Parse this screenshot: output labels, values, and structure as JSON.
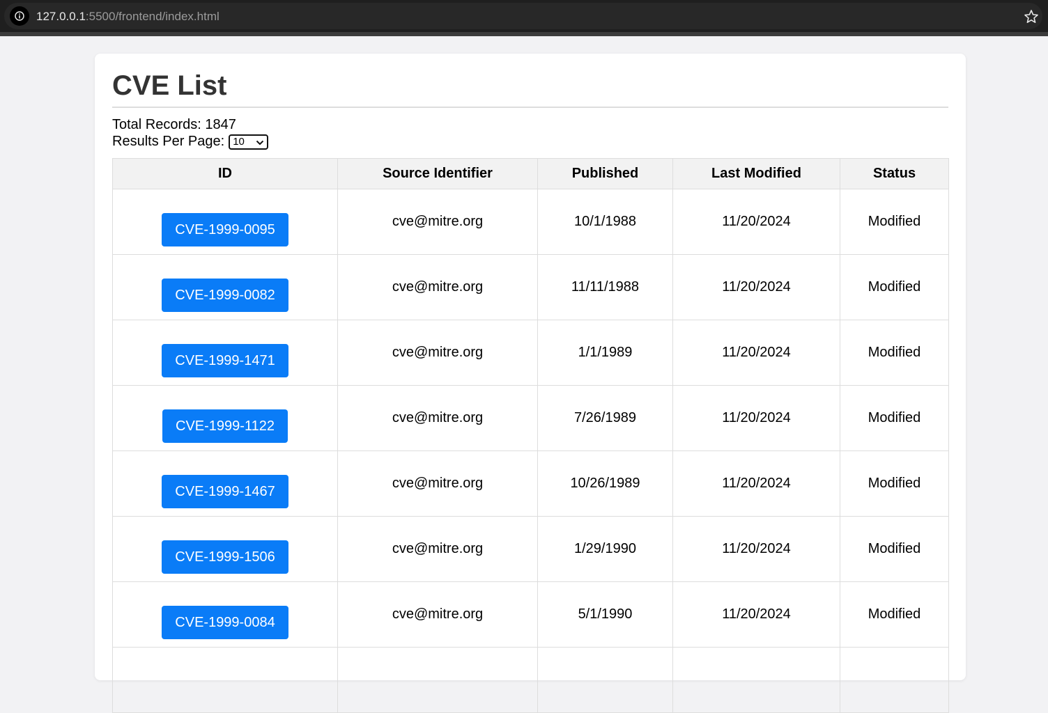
{
  "browser": {
    "url_host": "127.0.0.1",
    "url_rest": ":5500/frontend/index.html"
  },
  "page": {
    "title": "CVE List",
    "total_records_text": "Total Records: 1847",
    "per_page_label": "Results Per Page:",
    "per_page_value": "10"
  },
  "table": {
    "headers": [
      "ID",
      "Source Identifier",
      "Published",
      "Last Modified",
      "Status"
    ],
    "rows": [
      {
        "id": "CVE-1999-0095",
        "source": "cve@mitre.org",
        "published": "10/1/1988",
        "modified": "11/20/2024",
        "status": "Modified"
      },
      {
        "id": "CVE-1999-0082",
        "source": "cve@mitre.org",
        "published": "11/11/1988",
        "modified": "11/20/2024",
        "status": "Modified"
      },
      {
        "id": "CVE-1999-1471",
        "source": "cve@mitre.org",
        "published": "1/1/1989",
        "modified": "11/20/2024",
        "status": "Modified"
      },
      {
        "id": "CVE-1999-1122",
        "source": "cve@mitre.org",
        "published": "7/26/1989",
        "modified": "11/20/2024",
        "status": "Modified"
      },
      {
        "id": "CVE-1999-1467",
        "source": "cve@mitre.org",
        "published": "10/26/1989",
        "modified": "11/20/2024",
        "status": "Modified"
      },
      {
        "id": "CVE-1999-1506",
        "source": "cve@mitre.org",
        "published": "1/29/1990",
        "modified": "11/20/2024",
        "status": "Modified"
      },
      {
        "id": "CVE-1999-0084",
        "source": "cve@mitre.org",
        "published": "5/1/1990",
        "modified": "11/20/2024",
        "status": "Modified"
      },
      {
        "id": "",
        "source": "",
        "published": "",
        "modified": "",
        "status": ""
      }
    ]
  }
}
